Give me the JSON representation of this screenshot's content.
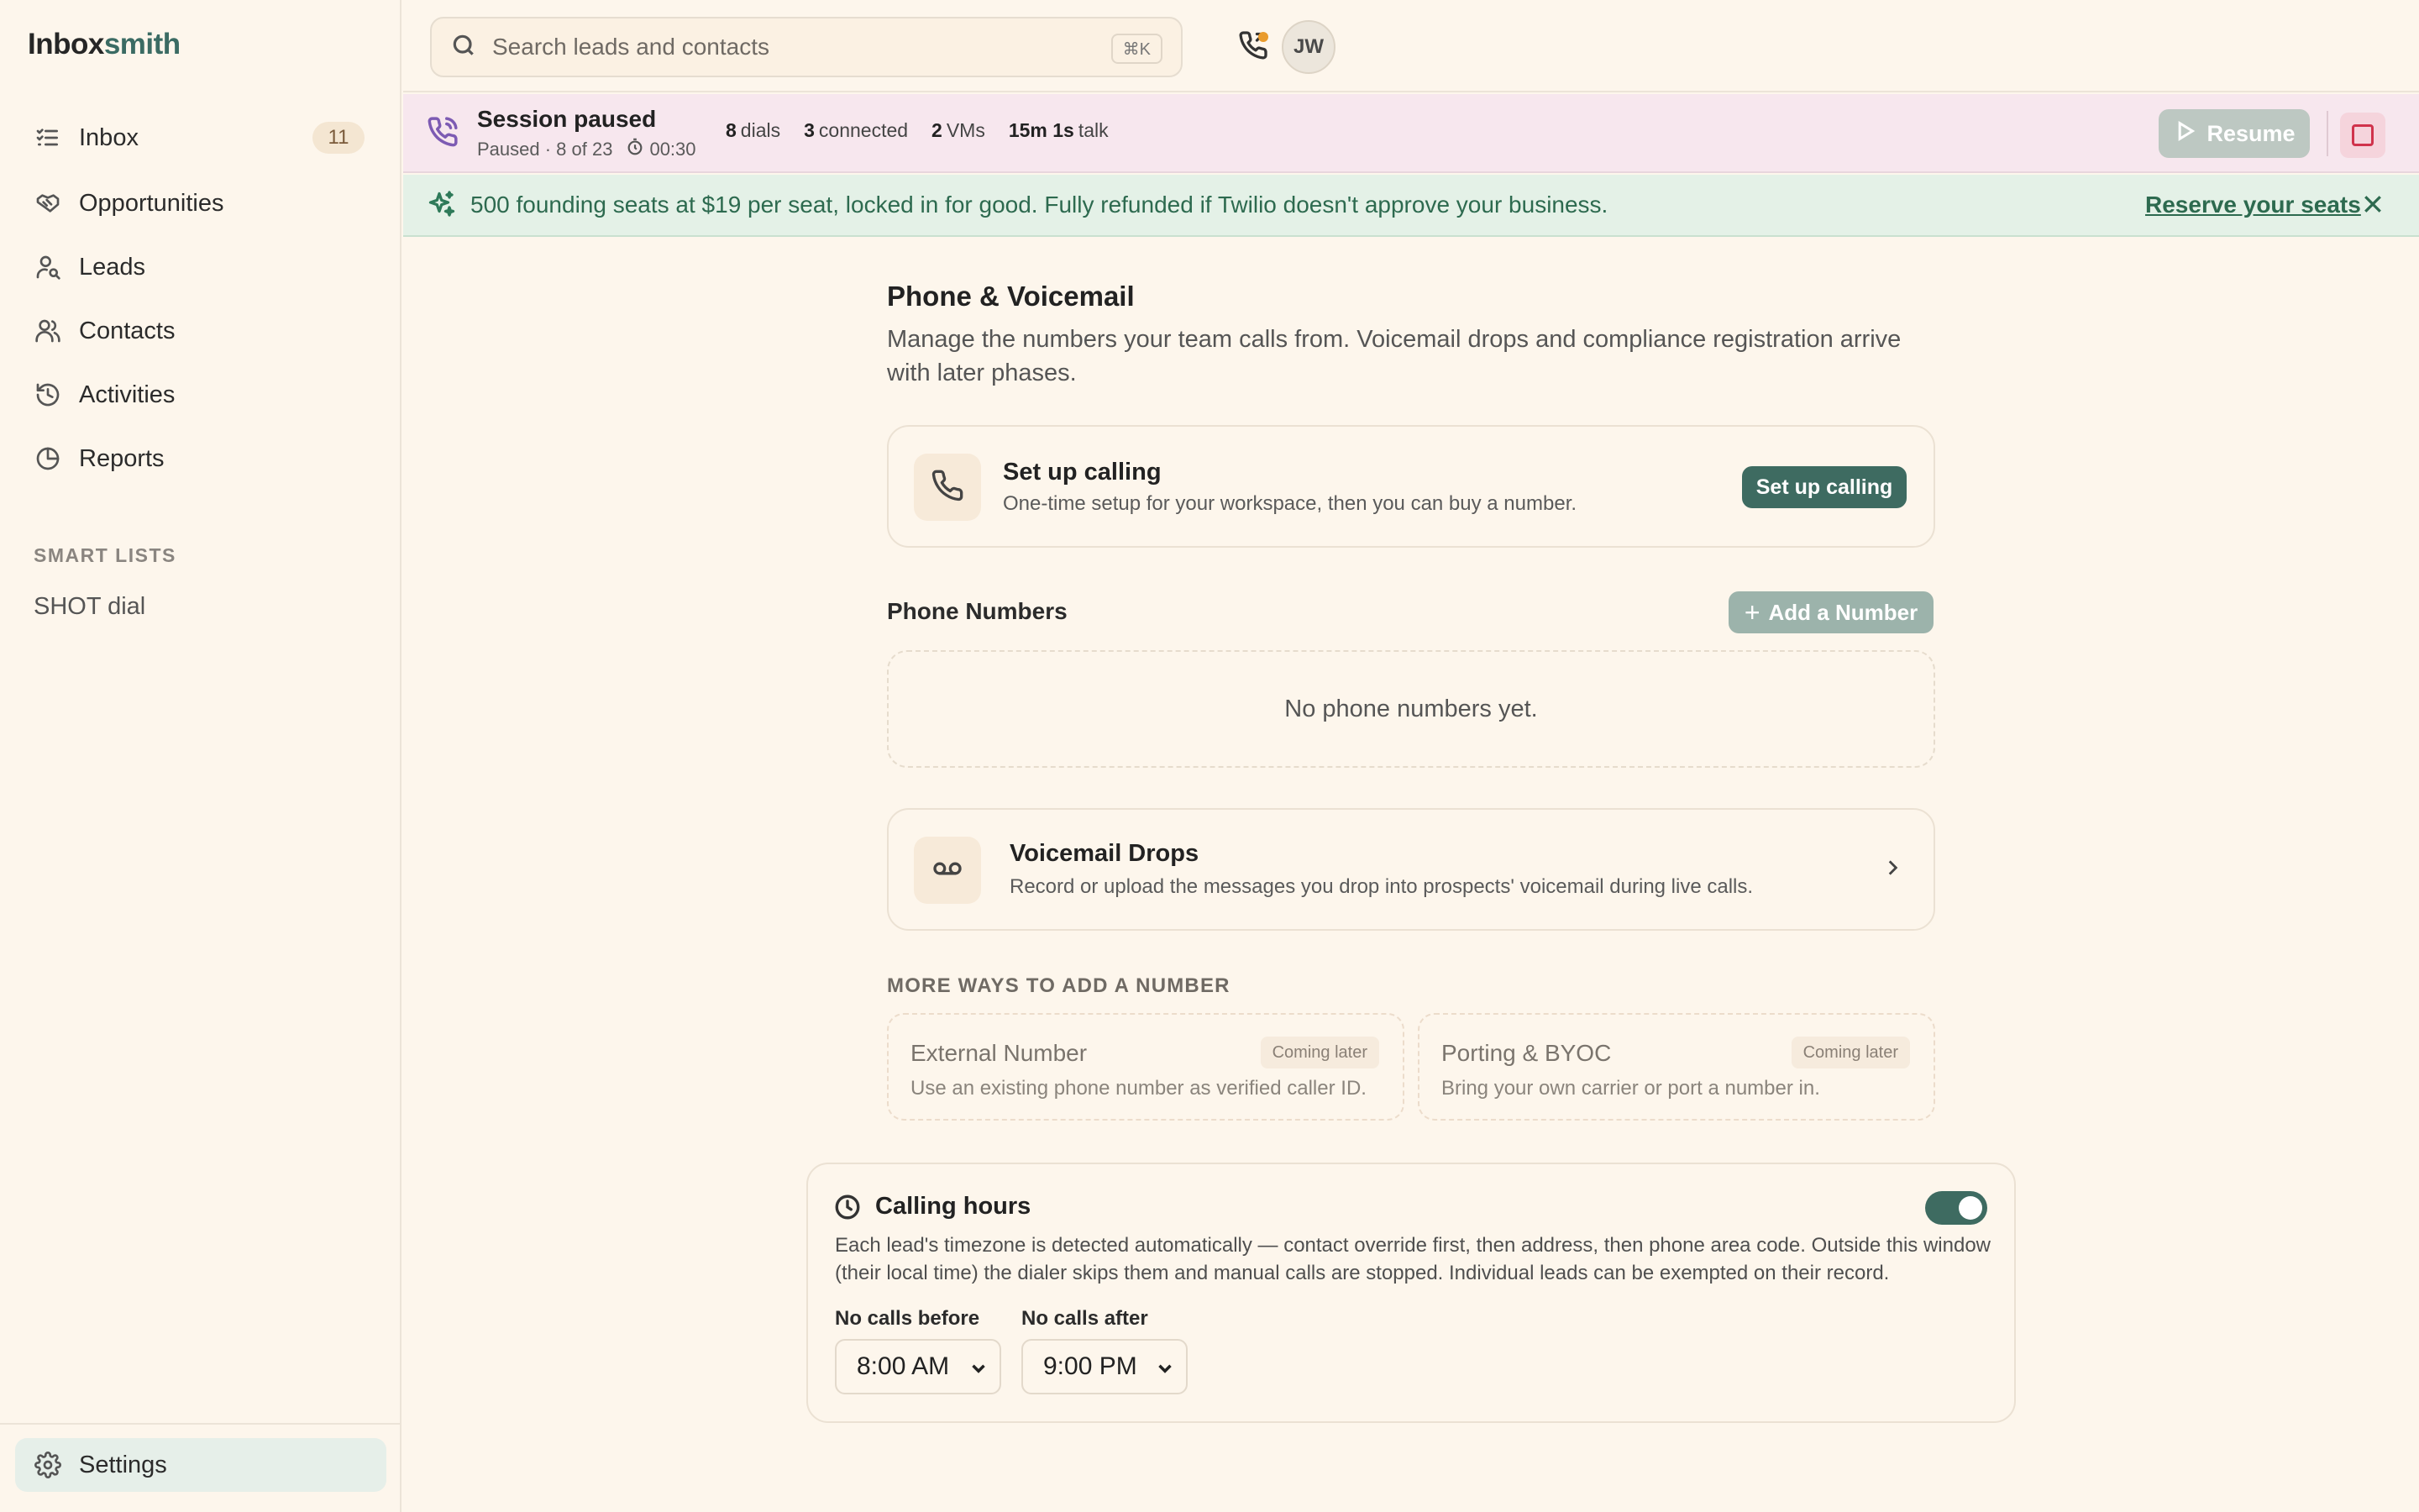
{
  "brand": {
    "part1": "Inbox",
    "part2": "smith"
  },
  "sidebar": {
    "items": [
      {
        "label": "Inbox",
        "icon": "list-check-icon",
        "badge": "11"
      },
      {
        "label": "Opportunities",
        "icon": "handshake-icon"
      },
      {
        "label": "Leads",
        "icon": "user-search-icon"
      },
      {
        "label": "Contacts",
        "icon": "users-icon"
      },
      {
        "label": "Activities",
        "icon": "history-icon"
      },
      {
        "label": "Reports",
        "icon": "pie-chart-icon"
      }
    ],
    "smart_lists_title": "SMART LISTS",
    "smart_lists": [
      "SHOT dial"
    ],
    "settings_label": "Settings"
  },
  "topbar": {
    "search_placeholder": "Search leads and contacts",
    "search_shortcut": "⌘K",
    "avatar_initials": "JW"
  },
  "session": {
    "title": "Session paused",
    "status": "Paused · 8 of 23",
    "timer": "00:30",
    "stats": [
      {
        "value": "8",
        "label": "dials"
      },
      {
        "value": "3",
        "label": "connected"
      },
      {
        "value": "2",
        "label": "VMs"
      },
      {
        "value": "15m 1s",
        "label": "talk"
      }
    ],
    "resume_label": "Resume"
  },
  "promo": {
    "text": "500 founding seats at $19 per seat, locked in for good. Fully refunded if Twilio doesn't approve your business.",
    "link": "Reserve your seats"
  },
  "page": {
    "title": "Phone & Voicemail",
    "description": "Manage the numbers your team calls from. Voicemail drops and compliance registration arrive with later phases."
  },
  "setup_card": {
    "title": "Set up calling",
    "subtitle": "One-time setup for your workspace, then you can buy a number.",
    "button": "Set up calling"
  },
  "phone_numbers": {
    "title": "Phone Numbers",
    "add_button": "Add a Number",
    "empty": "No phone numbers yet."
  },
  "voicemail_card": {
    "title": "Voicemail Drops",
    "subtitle": "Record or upload the messages you drop into prospects' voicemail during live calls."
  },
  "more_ways": {
    "title": "MORE WAYS TO ADD A NUMBER",
    "options": [
      {
        "title": "External Number",
        "subtitle": "Use an existing phone number as verified caller ID.",
        "badge": "Coming later"
      },
      {
        "title": "Porting & BYOC",
        "subtitle": "Bring your own carrier or port a number in.",
        "badge": "Coming later"
      }
    ]
  },
  "calling_hours": {
    "title": "Calling hours",
    "enabled": true,
    "description": "Each lead's timezone is detected automatically — contact override first, then address, then phone area code. Outside this window (their local time) the dialer skips them and manual calls are stopped. Individual leads can be exempted on their record.",
    "before_label": "No calls before",
    "before_value": "8:00 AM",
    "after_label": "No calls after",
    "after_value": "9:00 PM"
  },
  "colors": {
    "background": "#fdf6ec",
    "accent": "#3e6b61",
    "session_bg": "#f7e7ee",
    "promo_bg": "#e4f1e7",
    "stop_red": "#d0334c"
  }
}
